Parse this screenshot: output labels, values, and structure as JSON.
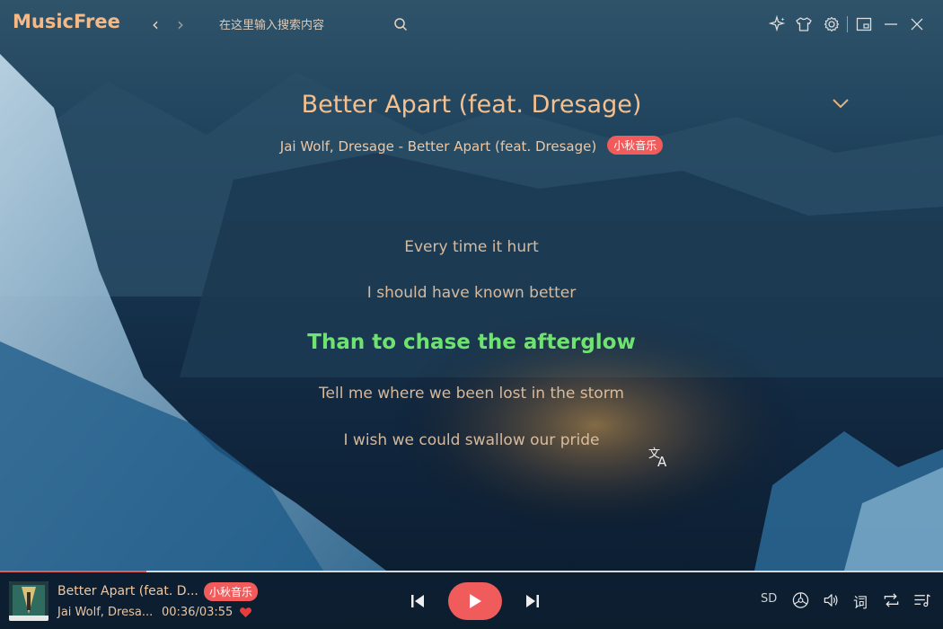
{
  "app": {
    "name": "MusicFree"
  },
  "search": {
    "placeholder": "在这里输入搜索内容"
  },
  "song": {
    "title": "Better Apart (feat. Dresage)",
    "subtitle": "Jai Wolf, Dresage - Better Apart (feat. Dresage)",
    "source_badge": "小秋音乐"
  },
  "lyrics": {
    "lines": [
      "Every time it hurt",
      "I should have known better",
      "Than to chase the afterglow",
      "Tell me where we been lost in the storm",
      "I wish we could swallow our pride"
    ],
    "current_index": 2
  },
  "player": {
    "title": "Better Apart (feat. D...",
    "artist": "Jai Wolf, Dresa...",
    "time": "00:36/03:55",
    "source_badge": "小秋音乐",
    "progress": 0.155,
    "quality": "SD",
    "lyric_button": "词",
    "liked": true
  },
  "colors": {
    "accent": "#f15b5b",
    "current_lyric": "#6fe36f",
    "logo": "#f6b985"
  },
  "icons": [
    "back-icon",
    "forward-icon",
    "search-icon",
    "sparkle-icon",
    "shirt-icon",
    "gear-icon",
    "mini-window-icon",
    "minimize-icon",
    "close-icon",
    "chevron-down-icon",
    "translate-icon",
    "heart-icon",
    "skip-previous-icon",
    "play-icon",
    "skip-next-icon",
    "sound-effect-icon",
    "volume-icon",
    "repeat-icon",
    "playlist-icon"
  ]
}
